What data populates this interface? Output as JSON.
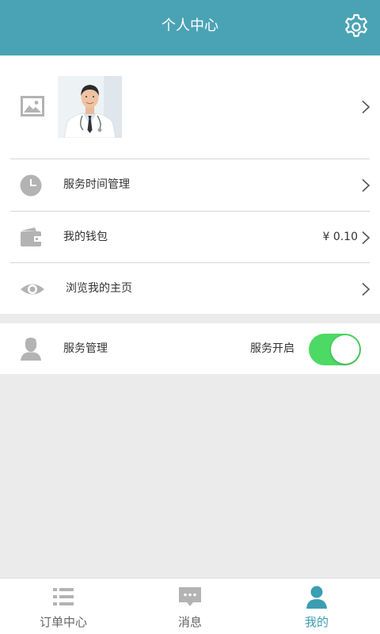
{
  "header": {
    "title": "个人中心",
    "settings_icon": "gear-icon"
  },
  "profile": {
    "placeholder_icon": "image-placeholder-icon",
    "avatar_alt": "医生头像"
  },
  "menu": [
    {
      "label": "服务时间管理",
      "icon": "clock-icon",
      "value": ""
    },
    {
      "label": "我的钱包",
      "icon": "wallet-icon",
      "value": "¥ 0.10"
    },
    {
      "label": "浏览我的主页",
      "icon": "eye-icon",
      "value": ""
    }
  ],
  "service": {
    "label": "服务管理",
    "icon": "user-icon",
    "status": "服务开启",
    "enabled": true
  },
  "tabs": [
    {
      "label": "订单中心",
      "icon": "list-icon",
      "active": false
    },
    {
      "label": "消息",
      "icon": "chat-bubble-icon",
      "active": false
    },
    {
      "label": "我的",
      "icon": "person-icon",
      "active": true
    }
  ],
  "colors": {
    "header": "#4aa3b4",
    "tab_active": "#3b9db1",
    "toggle_on": "#4cd964",
    "icon_gray": "#b3b3b3"
  }
}
